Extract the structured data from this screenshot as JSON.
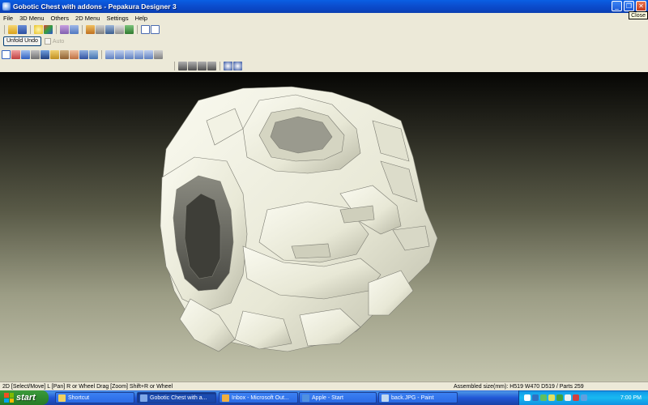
{
  "window": {
    "title": "Gobotic Chest with addons - Pepakura Designer 3",
    "minimize": "_",
    "maximize": "❐",
    "close": "✕",
    "close_tooltip": "Close"
  },
  "menu": [
    "File",
    "3D Menu",
    "Others",
    "2D Menu",
    "Settings",
    "Help"
  ],
  "toolbar": {
    "unfold_undo": "Unfold Undo",
    "auto_label": "Auto"
  },
  "status": {
    "left": "2D [Select/Move] L [Pan] R or Wheel Drag [Zoom] Shift+R or Wheel",
    "right": "Assembled size(mm): H519 W470 D519 / Parts 259"
  },
  "taskbar": {
    "start_label": "start",
    "tasks": [
      "Shortcut",
      "Gobotic Chest with a...",
      "Inbox - Microsoft Out...",
      "Apple - Start",
      "back.JPG - Paint"
    ],
    "clock": "7:00 PM"
  },
  "colors": {
    "accent": "#0a46c4",
    "viewport_top": "#060604",
    "viewport_bottom": "#c4c5ae",
    "model": "#ecebd8"
  }
}
